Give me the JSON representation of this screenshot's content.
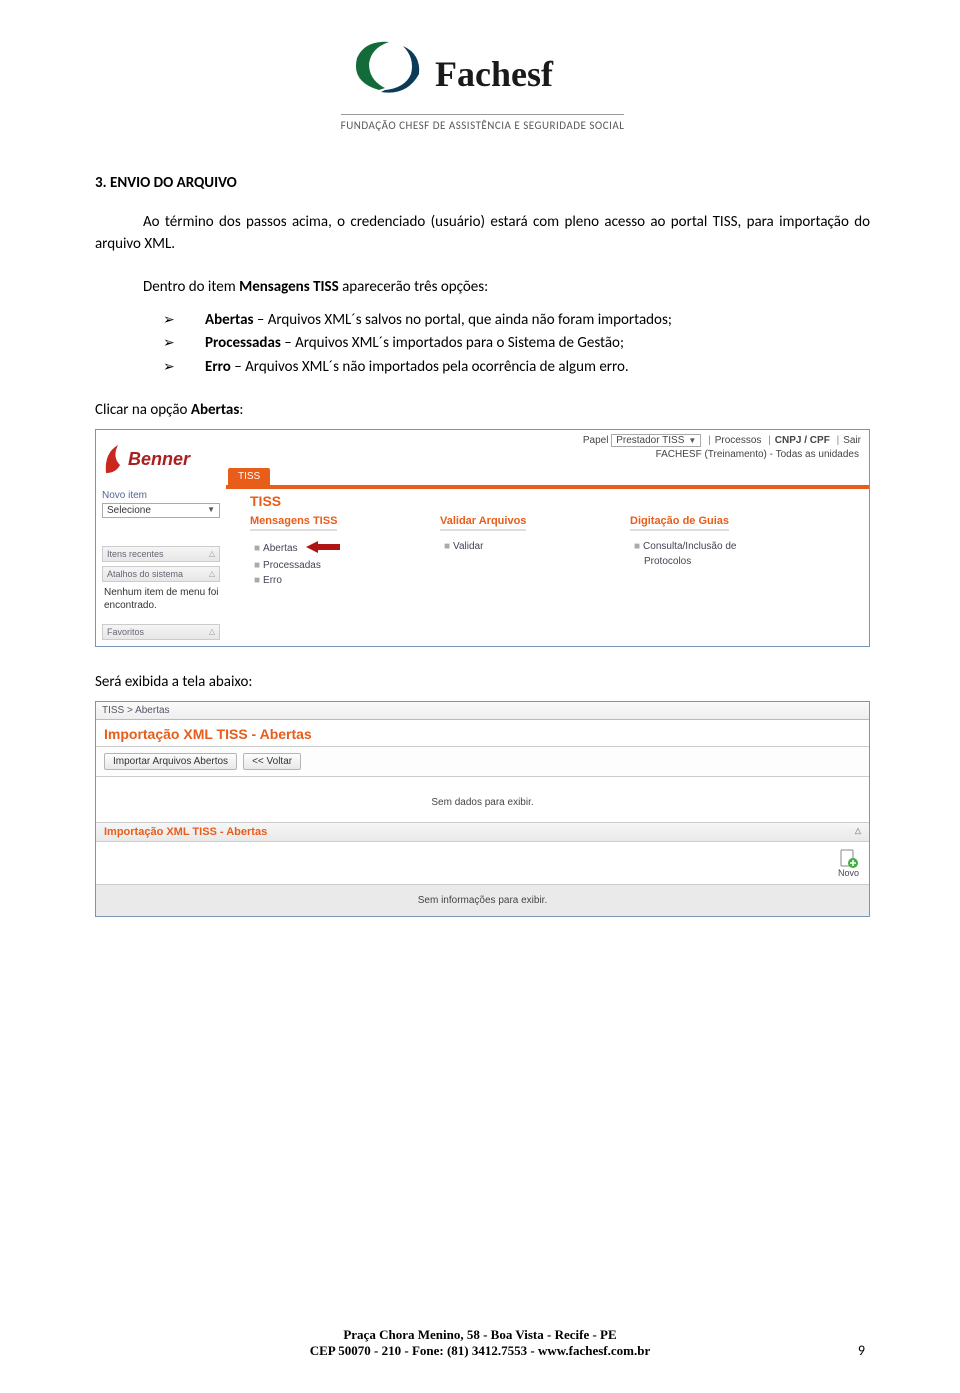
{
  "logo": {
    "name": "Fachesf",
    "subtitle": "FUNDAÇÃO CHESF DE ASSISTÊNCIA E SEGURIDADE SOCIAL"
  },
  "section": {
    "number": "3.",
    "title": "ENVIO DO ARQUIVO"
  },
  "para1": "Ao término dos passos acima, o credenciado (usuário) estará com pleno acesso ao portal TISS, para importação do arquivo XML.",
  "intro_list": "Dentro do item Mensagens TISS aparecerão três opções:",
  "options": [
    {
      "bold": "Abertas",
      "rest": " – Arquivos XML´s salvos no portal, que ainda não foram importados;"
    },
    {
      "bold": "Processadas",
      "rest": "  – Arquivos XML´s importados para o Sistema de Gestão;"
    },
    {
      "bold": "Erro",
      "rest": " – Arquivos XML´s não importados pela ocorrência de algum erro."
    }
  ],
  "click_label": {
    "pre": "Clicar na opção ",
    "bold": "Abertas",
    "post": ":"
  },
  "shot1": {
    "benner": "Benner",
    "novo_item": "Novo item",
    "selecione": "Selecione",
    "papel_row": {
      "label": "Papel",
      "value": "Prestador TISS",
      "links": [
        "Processos",
        "CNPJ / CPF",
        "Sair"
      ]
    },
    "sub_row": "FACHESF (Treinamento) - Todas as unidades",
    "tab": "TISS",
    "tiss_title": "TISS",
    "cols": [
      {
        "header": "Mensagens TISS",
        "items": [
          "Abertas",
          "Processadas",
          "Erro"
        ],
        "arrow_idx": 0
      },
      {
        "header": "Validar Arquivos",
        "items": [
          "Validar"
        ]
      },
      {
        "header": "Digitação de Guias",
        "items": [
          "Consulta/Inclusão de",
          "Protocolos"
        ]
      }
    ],
    "panels": [
      "Itens recentes",
      "Atalhos do sistema",
      "Favoritos"
    ],
    "nenhum": "Nenhum item de menu foi encontrado."
  },
  "will_show": "Será exibida a tela abaixo:",
  "shot2": {
    "crumb": "TISS > Abertas",
    "title": "Importação XML TISS - Abertas",
    "buttons": [
      "Importar Arquivos Abertos",
      "<< Voltar"
    ],
    "no_data": "Sem dados para exibir.",
    "sub_header": "Importação XML TISS - Abertas",
    "novo": "Novo",
    "no_info": "Sem informações para exibir."
  },
  "footer": {
    "line1": "Praça Chora Menino, 58 - Boa Vista - Recife - PE",
    "line2": "CEP 50070 - 210 - Fone: (81) 3412.7553 - www.fachesf.com.br"
  },
  "page_num": "9"
}
